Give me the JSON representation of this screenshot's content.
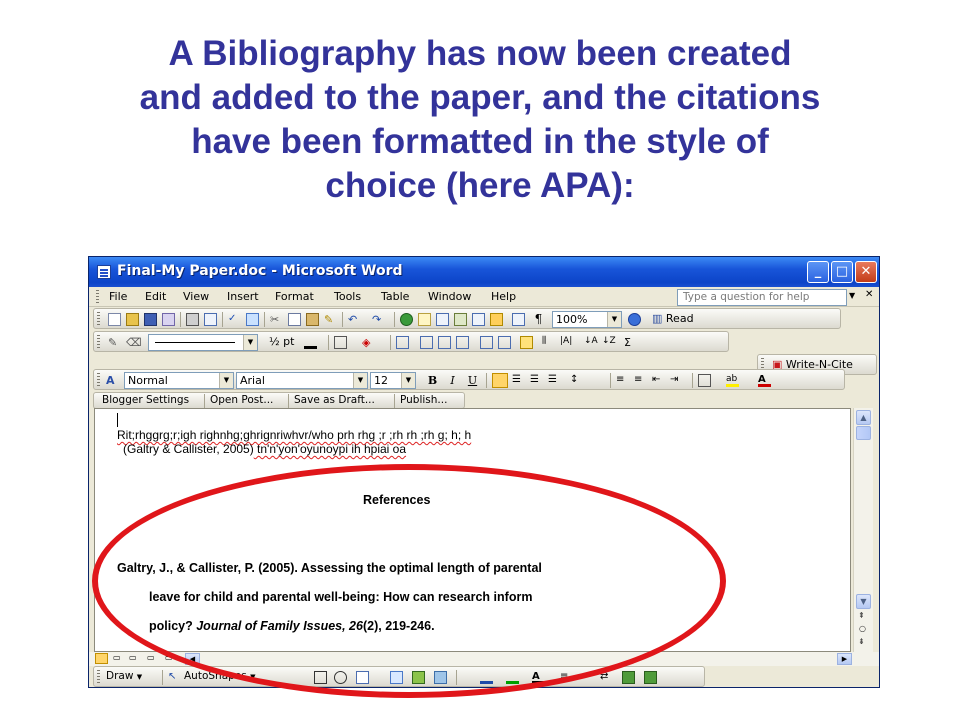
{
  "slide": {
    "title_lines": [
      "A Bibliography has now been created",
      "and added to the paper, and the citations",
      "have been formatted in the style of",
      "choice (here APA):"
    ]
  },
  "window": {
    "title": "Final-My Paper.doc - Microsoft Word",
    "min_btn": "_",
    "max_btn": "□",
    "close_btn": "✕"
  },
  "menu": {
    "items": [
      "File",
      "Edit",
      "View",
      "Insert",
      "Format",
      "Tools",
      "Table",
      "Window",
      "Help"
    ],
    "help_placeholder": "Type a question for help",
    "close_doc": "✕"
  },
  "standard_toolbar": {
    "zoom": "100%",
    "read_label": "Read",
    "pilcrow": "¶"
  },
  "drawing_toolbar_top": {
    "line_size": "½ pt"
  },
  "addin_toolbar": {
    "write_n_cite": "Write-N-Cite"
  },
  "formatting_toolbar": {
    "style": "Normal",
    "font": "Arial",
    "size": "12",
    "bold": "B",
    "italic": "I",
    "underline": "U"
  },
  "blogger_toolbar": {
    "items": [
      "Blogger Settings",
      "Open Post...",
      "Save as Draft...",
      "Publish..."
    ]
  },
  "document": {
    "line1": "Rit;rhggrg;r;igh righnhg;ghrignriwhvr/who prh rhg ;r ;rh rh ;rh g; h; h",
    "line2_citation": "(Galtry & Callister, 2005)",
    "line2_rest": " tn'n'yon'oyunoypi ih hpiai oa",
    "references_heading": "References",
    "ref_line1": "Galtry, J., & Callister, P. (2005). Assessing the optimal length of parental",
    "ref_line2": "leave for child and parental well-being: How can research inform",
    "ref_line3_a": "policy? ",
    "ref_line3_journal": "Journal of Family Issues, 26",
    "ref_line3_b": "(2), 219-246."
  },
  "drawing_toolbar": {
    "draw_label": "Draw",
    "autoshapes_label": "AutoShapes"
  },
  "colors": {
    "title_blue": "#33339a",
    "oval_red": "#e0161a",
    "titlebar_blue": "#0c44c8"
  }
}
